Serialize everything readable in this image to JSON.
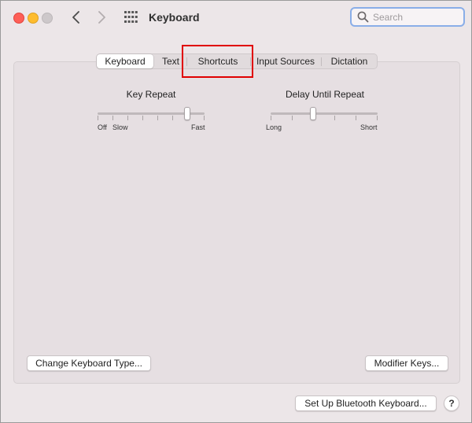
{
  "window": {
    "title": "Keyboard"
  },
  "search": {
    "placeholder": "Search",
    "value": ""
  },
  "tabs": [
    {
      "label": "Keyboard",
      "selected": true
    },
    {
      "label": "Text",
      "selected": false
    },
    {
      "label": "Shortcuts",
      "selected": false
    },
    {
      "label": "Input Sources",
      "selected": false
    },
    {
      "label": "Dictation",
      "selected": false
    }
  ],
  "key_repeat": {
    "title": "Key Repeat",
    "labels": {
      "off": "Off",
      "slow": "Slow",
      "fast": "Fast"
    },
    "ticks": 8,
    "value_fraction": 0.85
  },
  "delay_until_repeat": {
    "title": "Delay Until Repeat",
    "labels": {
      "long": "Long",
      "short": "Short"
    },
    "ticks": 6,
    "value_fraction": 0.4
  },
  "buttons": {
    "change_keyboard_type": "Change Keyboard Type...",
    "modifier_keys": "Modifier Keys...",
    "setup_bluetooth": "Set Up Bluetooth Keyboard...",
    "help": "?"
  },
  "colors": {
    "highlight": "#e00000",
    "search_focus": "#8aaee8"
  }
}
